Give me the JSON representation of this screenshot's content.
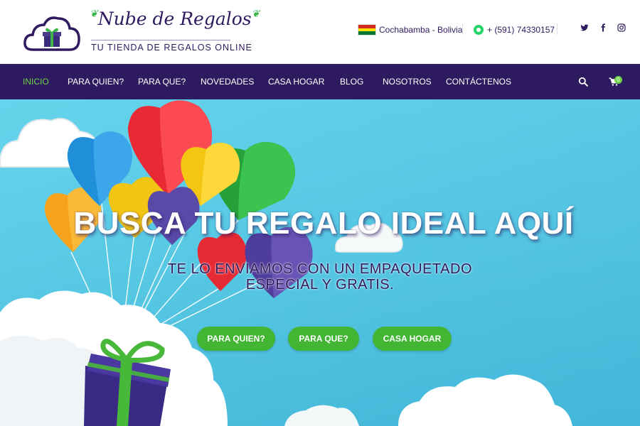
{
  "brand": {
    "name": "Nube de Regalos",
    "tagline": "TU TIENDA DE REGALOS ONLINE"
  },
  "header": {
    "location": "Cochabamba - Bolivia",
    "phone": "+ (591) 74330157",
    "social_icons": [
      "twitter-icon",
      "facebook-icon",
      "instagram-icon"
    ]
  },
  "nav": {
    "items": [
      {
        "label": "INICIO",
        "active": true
      },
      {
        "label": "PARA QUIEN?",
        "active": false
      },
      {
        "label": "PARA QUE?",
        "active": false
      },
      {
        "label": "NOVEDADES",
        "active": false
      },
      {
        "label": "CASA HOGAR",
        "active": false
      },
      {
        "label": "BLOG",
        "active": false
      },
      {
        "label": "NOSOTROS",
        "active": false
      },
      {
        "label": "CONTÁCTENOS",
        "active": false
      }
    ],
    "cart_count": "0"
  },
  "hero": {
    "title": "BUSCA TU REGALO IDEAL AQUÍ",
    "subtitle": "TE LO ENVIAMOS CON UN EMPAQUETADO ESPECIAL Y GRATIS.",
    "buttons": [
      "PARA QUIEN?",
      "PARA QUE?",
      "CASA HOGAR"
    ]
  },
  "colors": {
    "brand_purple": "#2e1a5e",
    "accent_green": "#42b533",
    "active_nav": "#6fd44a",
    "sky": "#57c9e4"
  }
}
